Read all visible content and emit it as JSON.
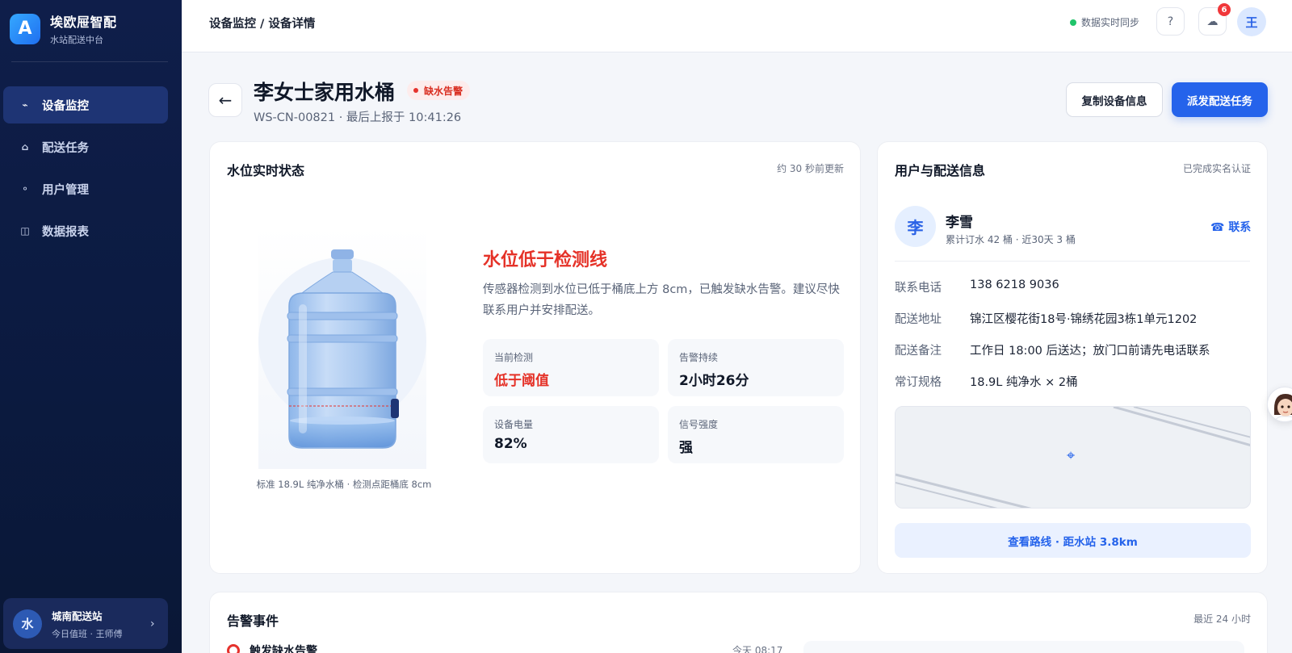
{
  "brand": {
    "logo_letter": "A",
    "name": "埃欧屉智配",
    "subtitle": "水站配送中台"
  },
  "nav": [
    {
      "icon": "⌁",
      "icon_name": "monitor-icon",
      "label": "设备监控",
      "active": true
    },
    {
      "icon": "⌂",
      "icon_name": "home-icon",
      "label": "配送任务",
      "active": false
    },
    {
      "icon": "⚬",
      "icon_name": "user-icon",
      "label": "用户管理",
      "active": false
    },
    {
      "icon": "◫",
      "icon_name": "report-icon",
      "label": "数据报表",
      "active": false
    }
  ],
  "station": {
    "avatar": "水",
    "name": "城南配送站",
    "duty": "今日值班 · 王师傅",
    "chevron": "›"
  },
  "header": {
    "breadcrumb": "设备监控 / 设备详情",
    "sync_text": "数据实时同步",
    "help_icon": "?",
    "notify_icon": "☁",
    "notify_count": "6",
    "user_avatar": "王"
  },
  "page": {
    "back_icon": "←",
    "title": "李女士家用水桶",
    "alert_badge": "缺水告警",
    "subtitle": "WS-CN-00821 · 最后上报于 10:41:26",
    "copy_button": "复制设备信息",
    "dispatch_button": "派发配送任务"
  },
  "water_card": {
    "title": "水位实时状态",
    "updated": "约 30 秒前更新",
    "caption": "标准 18.9L 纯净水桶 · 检测点距桶底 8cm",
    "status_title": "水位低于检测线",
    "status_desc": "传感器检测到水位已低于桶底上方 8cm，已触发缺水告警。建议尽快联系用户并安排配送。",
    "stats": [
      {
        "label": "当前检测",
        "value": "低于阈值",
        "alert": true
      },
      {
        "label": "告警持续",
        "value": "2小时26分",
        "alert": false
      },
      {
        "label": "设备电量",
        "value": "82%",
        "alert": false
      },
      {
        "label": "信号强度",
        "value": "强",
        "alert": false
      }
    ]
  },
  "user_card": {
    "title": "用户与配送信息",
    "verified": "已完成实名认证",
    "avatar": "李",
    "name": "李雪",
    "summary": "累计订水 42 桶 · 近30天 3 桶",
    "contact": "☎ 联系",
    "rows": [
      {
        "label": "联系电话",
        "value": "138 6218 9036"
      },
      {
        "label": "配送地址",
        "value": "锦江区樱花街18号·锦绣花园3栋1单元1202"
      },
      {
        "label": "配送备注",
        "value": "工作日 18:00 后送达；放门口前请先电话联系"
      },
      {
        "label": "常订规格",
        "value": "18.9L 纯净水 × 2桶"
      }
    ],
    "map_marker": "⌖",
    "route_button": "查看路线 · 距水站 3.8km"
  },
  "events_card": {
    "title": "告警事件",
    "range": "最近 24 小时",
    "items": [
      {
        "title": "触发缺水告警",
        "time": "今天 08:17"
      }
    ]
  },
  "colors": {
    "primary": "#2563eb",
    "alert": "#e53228",
    "sidebar": "#0f1e4a",
    "success": "#20c46a"
  }
}
